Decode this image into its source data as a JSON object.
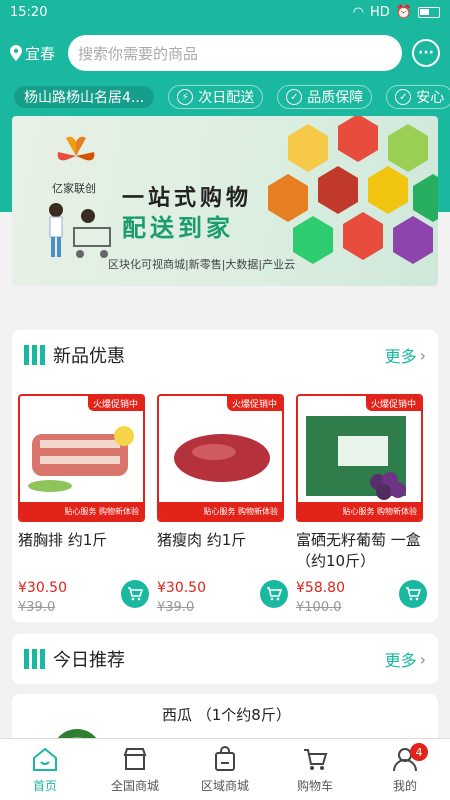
{
  "status": {
    "time": "15:20",
    "network": "HD"
  },
  "header": {
    "location": "宜春",
    "search_placeholder": "搜索你需要的商品"
  },
  "tagbar": {
    "address": "杨山路杨山名居4...",
    "tags": [
      "次日配送",
      "品质保障",
      "安心"
    ]
  },
  "banner": {
    "logo_text": "亿家联创",
    "title1": "一站式购物",
    "title2": "配送到家",
    "subtitle": "区块化可视商城|新零售|大数据|产业云"
  },
  "new_products": {
    "title": "新品优惠",
    "more": "更多",
    "items": [
      {
        "name": "猪胸排 约1斤",
        "price": "¥30.50",
        "old_price": "¥39.0",
        "promo": "火爆促销中",
        "foot": "贴心服务 购物新体验"
      },
      {
        "name": "猪瘦肉 约1斤",
        "price": "¥30.50",
        "old_price": "¥39.0",
        "promo": "火爆促销中",
        "foot": "贴心服务 购物新体验"
      },
      {
        "name": "富硒无籽葡萄 一盒（约10斤）",
        "price": "¥58.80",
        "old_price": "¥100.0",
        "promo": "火爆促销中",
        "foot": "贴心服务 购物新体验"
      }
    ]
  },
  "recommend": {
    "title": "今日推荐",
    "more": "更多",
    "first_item": "西瓜 （1个约8斤）"
  },
  "tabbar": {
    "items": [
      "首页",
      "全国商城",
      "区域商城",
      "购物车",
      "我的"
    ],
    "badge": "4"
  },
  "colors": {
    "accent": "#1bb8a0",
    "price": "#e2231a"
  }
}
